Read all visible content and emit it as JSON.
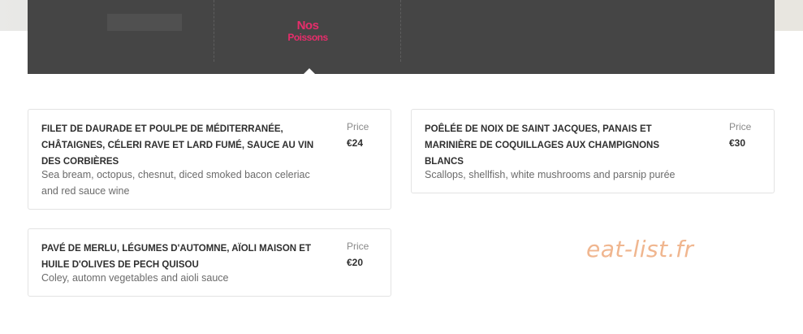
{
  "nav": {
    "active_tab": {
      "line1": "Nos",
      "line2": "Poissons"
    }
  },
  "menu": {
    "items": [
      {
        "name_lines": [
          "FILET DE DAURADE ET POULPE DE MÉDITERRANÉE,",
          "CHÂTAIGNES, CÉLERI RAVE ET LARD FUMÉ, SAUCE AU VIN",
          "DES CORBIÈRES"
        ],
        "description_lines": [
          "Sea bream, octopus, chesnut,  diced smoked bacon celeriac",
          "and red sauce wine"
        ],
        "price_label": "Price",
        "price": "€24"
      },
      {
        "name_lines": [
          "POÊLÉE DE NOIX DE SAINT JACQUES, PANAIS ET",
          "MARINIÈRE DE COQUILLAGES AUX CHAMPIGNONS",
          "BLANCS"
        ],
        "description_lines": [
          "Scallops, shellfish, white mushrooms and parsnip purée"
        ],
        "price_label": "Price",
        "price": "€30"
      },
      {
        "name_lines": [
          "PAVÉ DE MERLU, LÉGUMES D'AUTOMNE, AÏOLI MAISON ET",
          "HUILE D'OLIVES DE PECH QUISOU"
        ],
        "description_lines": [
          "Coley, automn vegetables and aioli sauce"
        ],
        "price_label": "Price",
        "price": "€20"
      }
    ]
  },
  "watermark": "eat-list.fr",
  "colors": {
    "accent": "#e72d6b",
    "tabbar": "#454545",
    "watermark": "#f0b68f"
  }
}
